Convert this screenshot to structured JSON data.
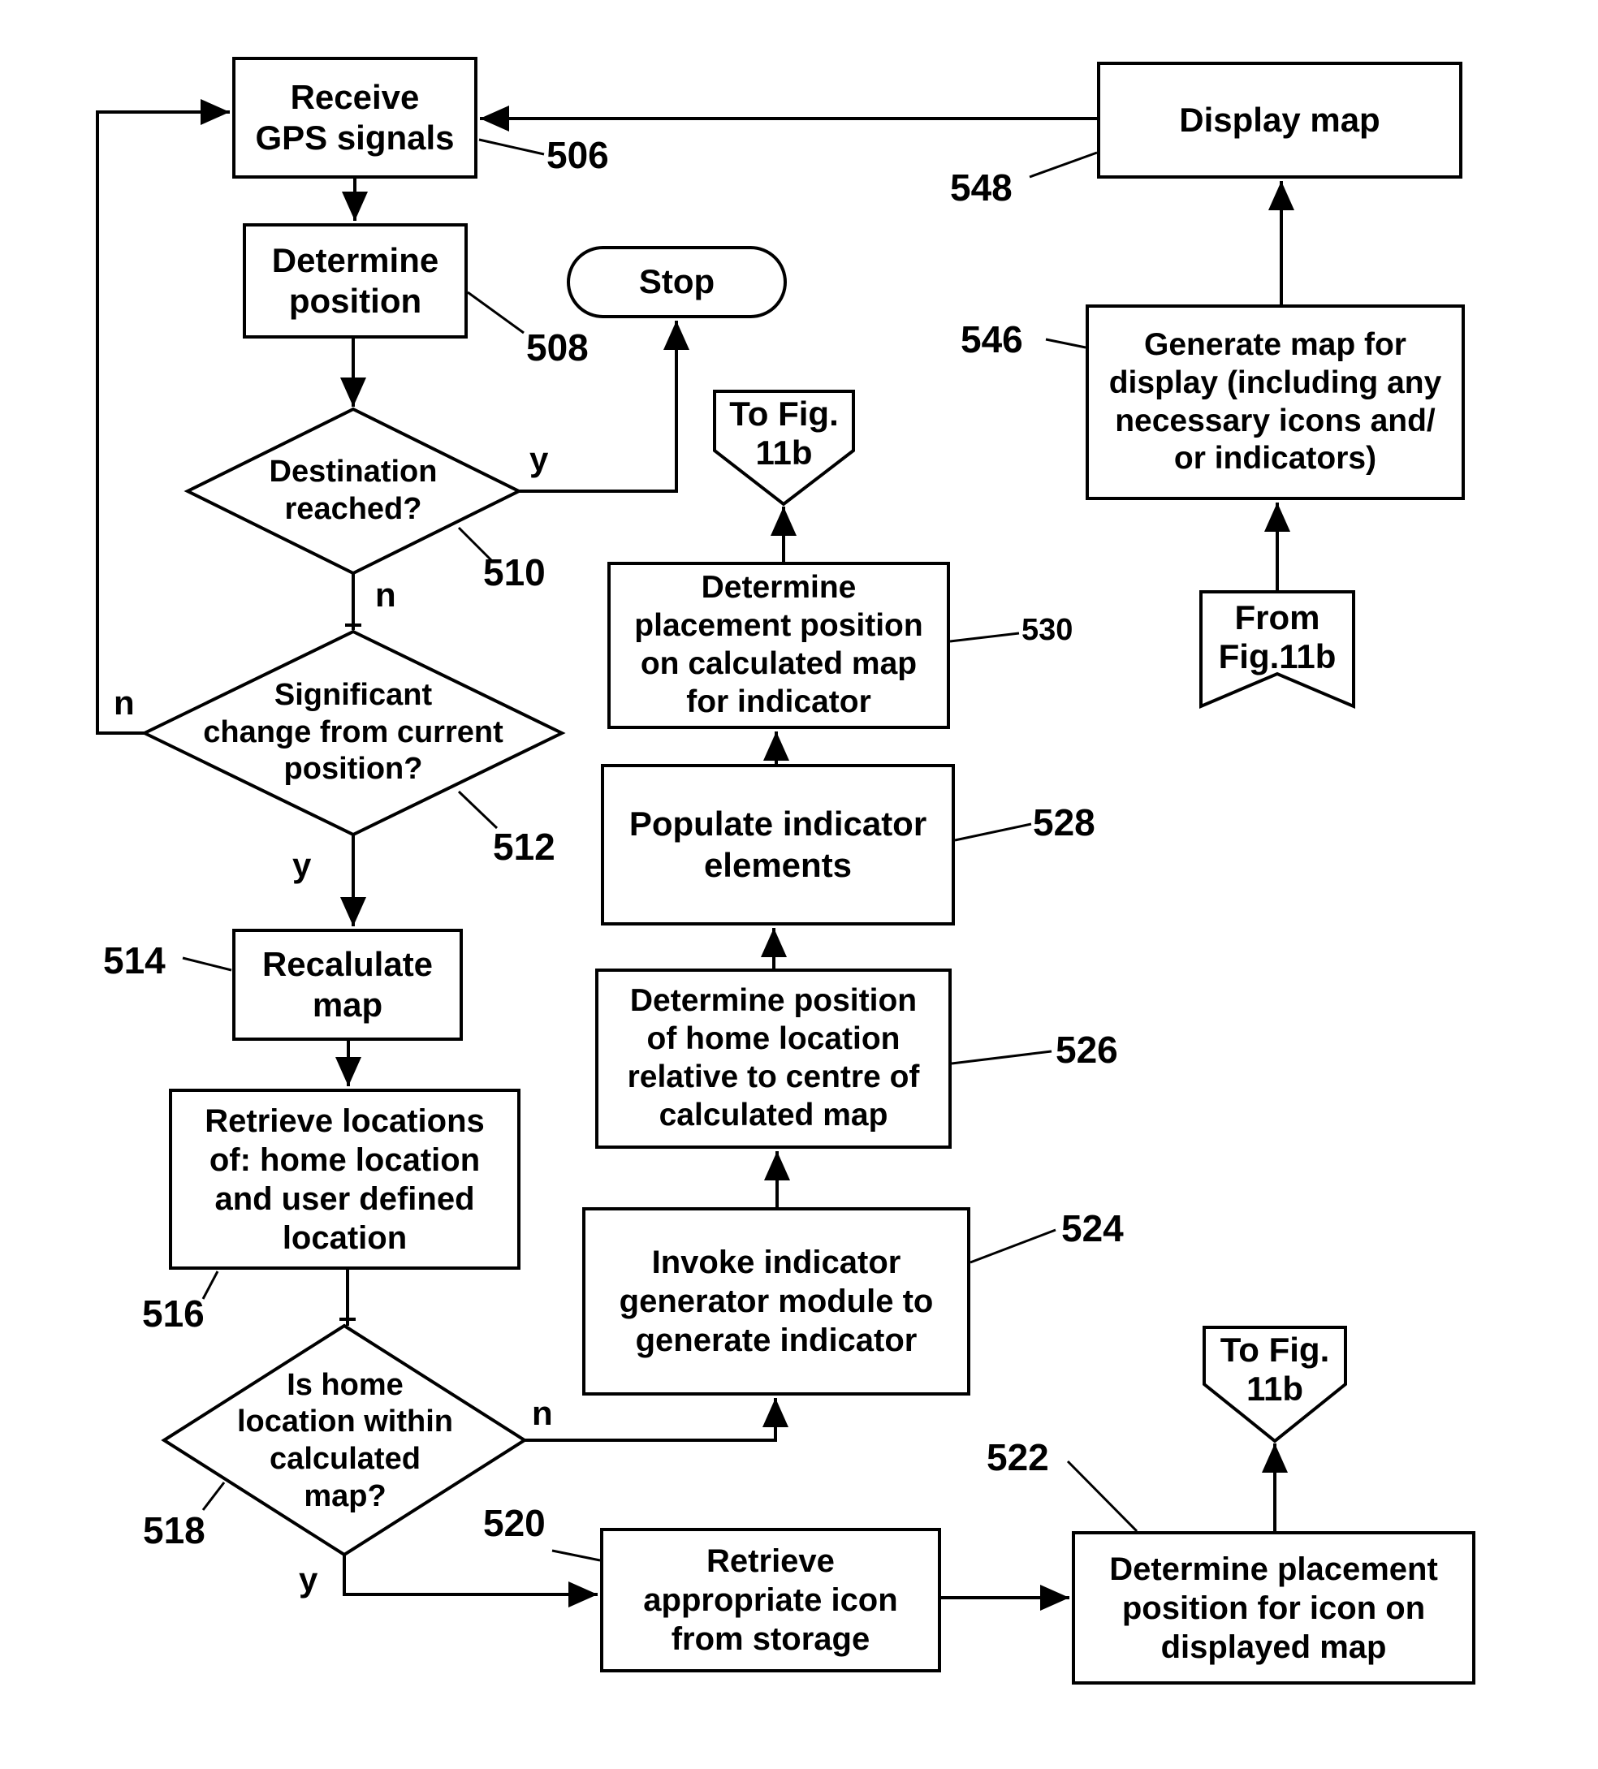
{
  "figure": {
    "steps": {
      "s506": {
        "label": "Receive\nGPS signals",
        "ref": "506"
      },
      "s508": {
        "label": "Determine\nposition",
        "ref": "508"
      },
      "stop": {
        "label": "Stop"
      },
      "s510": {
        "label": "Destination\nreached?",
        "ref": "510",
        "yes": "y",
        "no": "n"
      },
      "s512": {
        "label": "Significant\nchange from current\nposition?",
        "ref": "512",
        "yes": "y",
        "no": "n"
      },
      "s514": {
        "label": "Recalulate\nmap",
        "ref": "514"
      },
      "s516": {
        "label": "Retrieve locations\nof: home location\nand user defined\nlocation",
        "ref": "516"
      },
      "s518": {
        "label": "Is home\nlocation within\ncalculated\nmap?",
        "ref": "518",
        "yes": "y",
        "no": "n"
      },
      "s520": {
        "label": "Retrieve\nappropriate icon\nfrom storage",
        "ref": "520"
      },
      "s522": {
        "label": "Determine placement\nposition for icon on\ndisplayed map",
        "ref": "522"
      },
      "s524": {
        "label": "Invoke indicator\ngenerator module to\ngenerate indicator",
        "ref": "524"
      },
      "s526": {
        "label": "Determine position\nof home location\nrelative to centre of\ncalculated map",
        "ref": "526"
      },
      "s528": {
        "label": "Populate indicator\nelements",
        "ref": "528"
      },
      "s530": {
        "label": "Determine\nplacement position\non calculated map\nfor indicator",
        "ref": "530"
      },
      "s546": {
        "label": "Generate map for\ndisplay (including any\nnecessary icons and/\nor indicators)",
        "ref": "546"
      },
      "s548": {
        "label": "Display map",
        "ref": "548"
      }
    },
    "connectors": {
      "to_top": {
        "label": "To Fig.\n11b"
      },
      "to_bottom": {
        "label": "To Fig.\n11b"
      },
      "from": {
        "label": "From\nFig.11b"
      }
    }
  }
}
